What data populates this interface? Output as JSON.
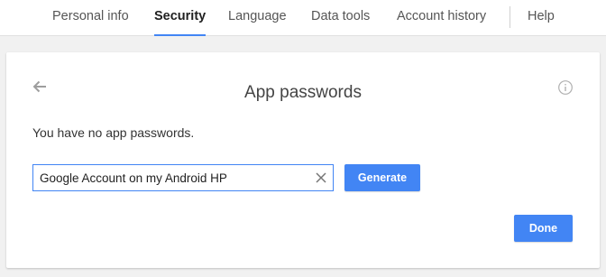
{
  "nav": {
    "tabs": [
      {
        "label": "Personal info"
      },
      {
        "label": "Security"
      },
      {
        "label": "Language"
      },
      {
        "label": "Data tools"
      },
      {
        "label": "Account history"
      }
    ],
    "help": "Help",
    "active_tab": "Security"
  },
  "dialog": {
    "title": "App passwords",
    "message": "You have no app passwords.",
    "input_value": "Google Account on my Android HP",
    "generate_label": "Generate",
    "done_label": "Done",
    "icons": {
      "back": "arrow-left-icon",
      "info": "info-icon",
      "clear": "close-icon"
    }
  },
  "colors": {
    "accent": "#4285f4",
    "background": "#f1f1f1"
  }
}
